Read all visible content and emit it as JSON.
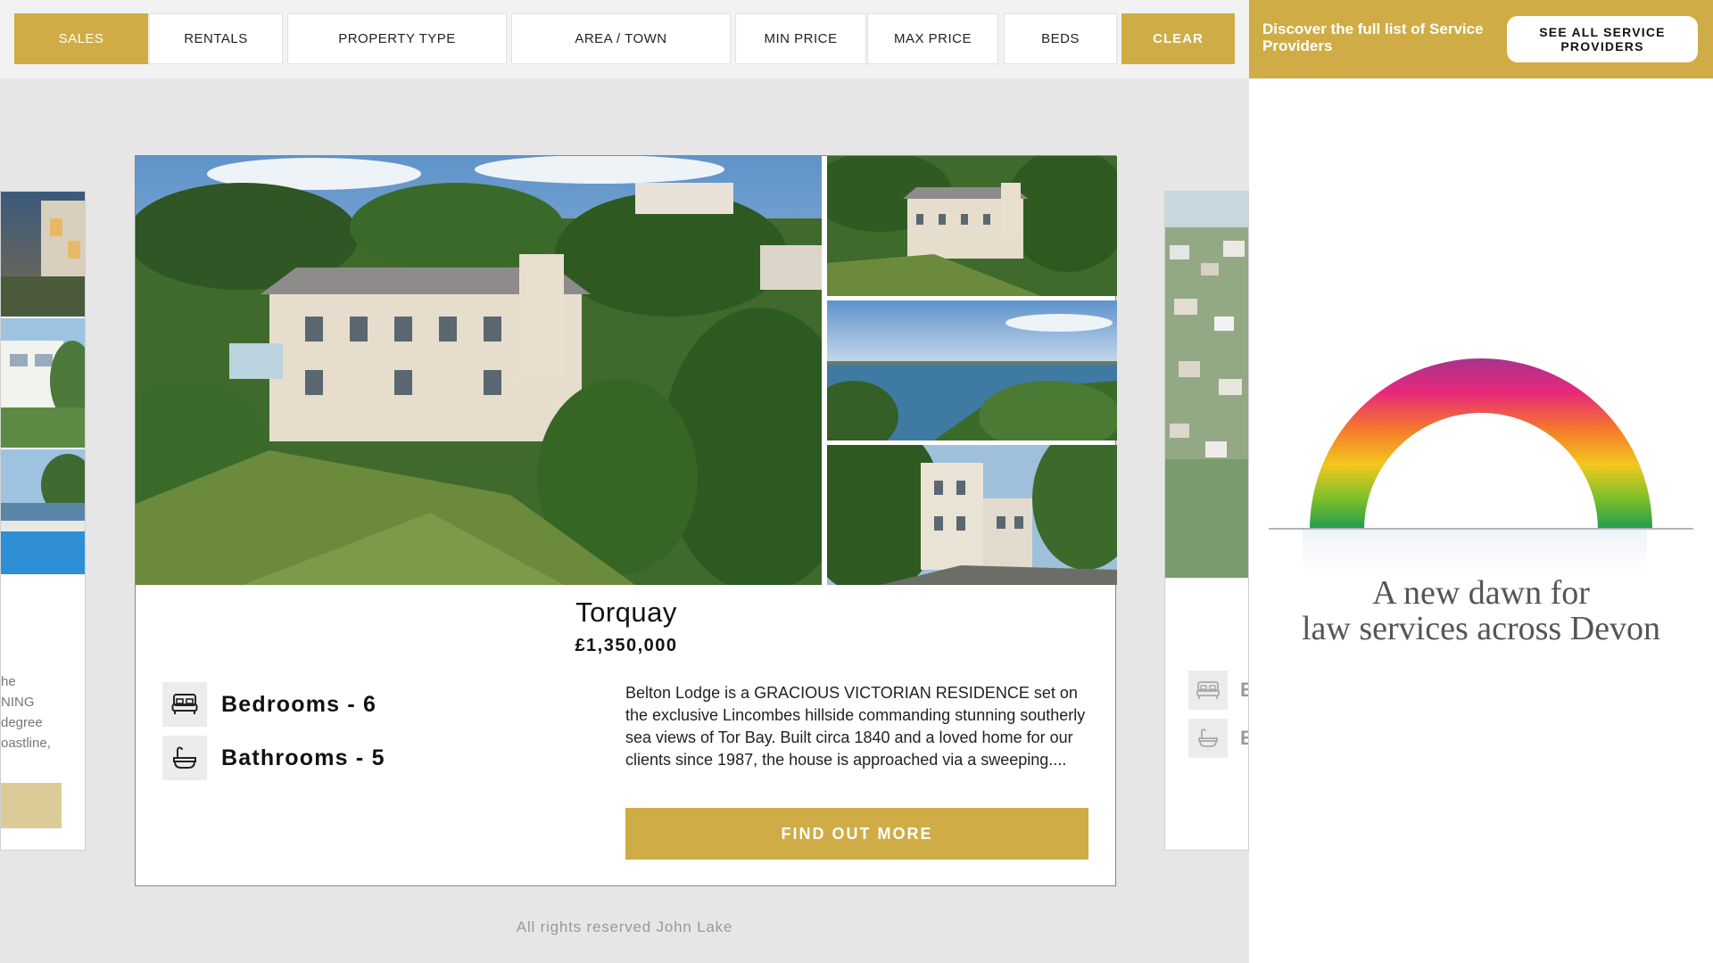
{
  "filters": {
    "sales": "SALES",
    "rentals": "RENTALS",
    "property_type": "PROPERTY TYPE",
    "area_town": "AREA / TOWN",
    "min_price": "MIN PRICE",
    "max_price": "MAX PRICE",
    "beds": "BEDS",
    "clear": "CLEAR",
    "active": "SALES"
  },
  "sidebar": {
    "banner_text": "Discover the full list of Service Providers",
    "banner_button": "SEE ALL SERVICE PROVIDERS",
    "ad": {
      "line1": "A new dawn for",
      "line2": "law services across Devon"
    }
  },
  "listing": {
    "town": "Torquay",
    "price": "£1,350,000",
    "bedrooms": "Bedrooms - 6",
    "bathrooms": "Bathrooms - 5",
    "description": "Belton Lodge is a GRACIOUS VICTORIAN RESIDENCE set on the exclusive Lincombes hillside commanding stunning southerly sea views of Tor Bay. Built circa 1840 and a loved home for our clients since 1987, the house is approached via a sweeping....",
    "cta": "FIND OUT MORE"
  },
  "peek_left": {
    "text_lines": [
      "he",
      "NING",
      "degree",
      "oastline,"
    ]
  },
  "peek_right": {
    "bed_letter": "B",
    "bath_letter": "B"
  },
  "footer": "All rights reserved John Lake",
  "colors": {
    "accent": "#cfac45",
    "page_bg": "#e6e6e6"
  },
  "icons": {
    "bedroom": "bed-icon",
    "bathroom": "bath-icon"
  }
}
